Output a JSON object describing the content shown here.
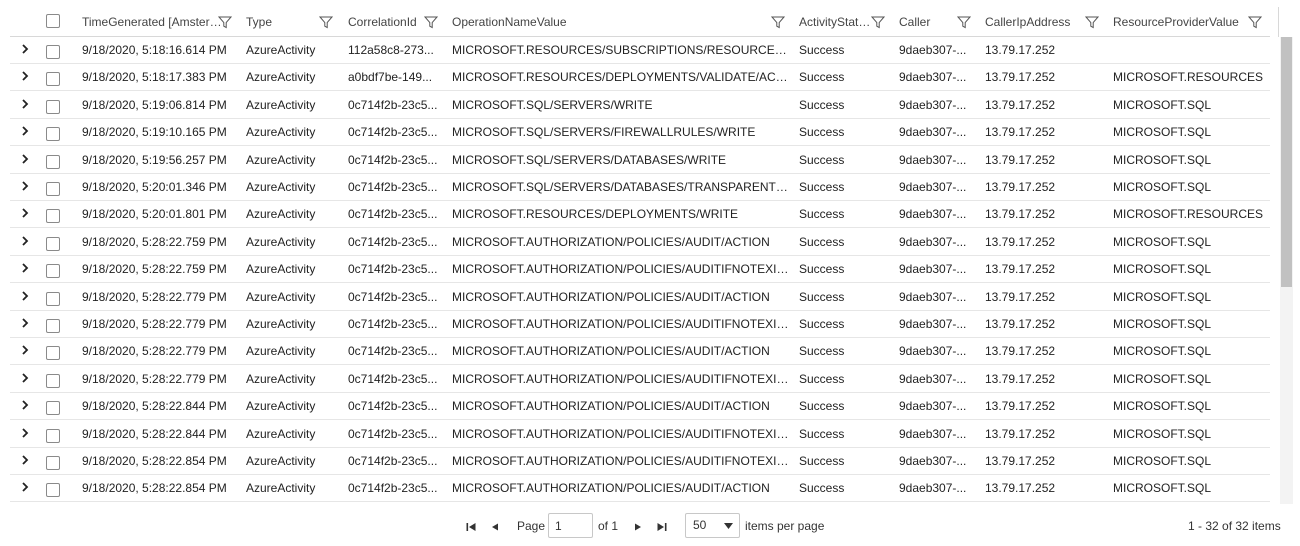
{
  "columns": [
    {
      "key": "time",
      "label": "TimeGenerated [Amster…"
    },
    {
      "key": "type",
      "label": "Type"
    },
    {
      "key": "corr",
      "label": "CorrelationId"
    },
    {
      "key": "op",
      "label": "OperationNameValue"
    },
    {
      "key": "status",
      "label": "ActivityStat…"
    },
    {
      "key": "caller",
      "label": "Caller"
    },
    {
      "key": "ip",
      "label": "CallerIpAddress"
    },
    {
      "key": "rp",
      "label": "ResourceProviderValue"
    }
  ],
  "rows": [
    {
      "time": "9/18/2020, 5:18:16.614 PM",
      "type": "AzureActivity",
      "corr": "112a58c8-273...",
      "op": "MICROSOFT.RESOURCES/SUBSCRIPTIONS/RESOURCEGROU...",
      "status": "Success",
      "caller": "9daeb307-...",
      "ip": "13.79.17.252",
      "rp": ""
    },
    {
      "time": "9/18/2020, 5:18:17.383 PM",
      "type": "AzureActivity",
      "corr": "a0bdf7be-149...",
      "op": "MICROSOFT.RESOURCES/DEPLOYMENTS/VALIDATE/ACTION",
      "status": "Success",
      "caller": "9daeb307-...",
      "ip": "13.79.17.252",
      "rp": "MICROSOFT.RESOURCES"
    },
    {
      "time": "9/18/2020, 5:19:06.814 PM",
      "type": "AzureActivity",
      "corr": "0c714f2b-23c5...",
      "op": "MICROSOFT.SQL/SERVERS/WRITE",
      "status": "Success",
      "caller": "9daeb307-...",
      "ip": "13.79.17.252",
      "rp": "MICROSOFT.SQL"
    },
    {
      "time": "9/18/2020, 5:19:10.165 PM",
      "type": "AzureActivity",
      "corr": "0c714f2b-23c5...",
      "op": "MICROSOFT.SQL/SERVERS/FIREWALLRULES/WRITE",
      "status": "Success",
      "caller": "9daeb307-...",
      "ip": "13.79.17.252",
      "rp": "MICROSOFT.SQL"
    },
    {
      "time": "9/18/2020, 5:19:56.257 PM",
      "type": "AzureActivity",
      "corr": "0c714f2b-23c5...",
      "op": "MICROSOFT.SQL/SERVERS/DATABASES/WRITE",
      "status": "Success",
      "caller": "9daeb307-...",
      "ip": "13.79.17.252",
      "rp": "MICROSOFT.SQL"
    },
    {
      "time": "9/18/2020, 5:20:01.346 PM",
      "type": "AzureActivity",
      "corr": "0c714f2b-23c5...",
      "op": "MICROSOFT.SQL/SERVERS/DATABASES/TRANSPARENTDAT...",
      "status": "Success",
      "caller": "9daeb307-...",
      "ip": "13.79.17.252",
      "rp": "MICROSOFT.SQL"
    },
    {
      "time": "9/18/2020, 5:20:01.801 PM",
      "type": "AzureActivity",
      "corr": "0c714f2b-23c5...",
      "op": "MICROSOFT.RESOURCES/DEPLOYMENTS/WRITE",
      "status": "Success",
      "caller": "9daeb307-...",
      "ip": "13.79.17.252",
      "rp": "MICROSOFT.RESOURCES"
    },
    {
      "time": "9/18/2020, 5:28:22.759 PM",
      "type": "AzureActivity",
      "corr": "0c714f2b-23c5...",
      "op": "MICROSOFT.AUTHORIZATION/POLICIES/AUDIT/ACTION",
      "status": "Success",
      "caller": "9daeb307-...",
      "ip": "13.79.17.252",
      "rp": "MICROSOFT.SQL"
    },
    {
      "time": "9/18/2020, 5:28:22.759 PM",
      "type": "AzureActivity",
      "corr": "0c714f2b-23c5...",
      "op": "MICROSOFT.AUTHORIZATION/POLICIES/AUDITIFNOTEXISTS...",
      "status": "Success",
      "caller": "9daeb307-...",
      "ip": "13.79.17.252",
      "rp": "MICROSOFT.SQL"
    },
    {
      "time": "9/18/2020, 5:28:22.779 PM",
      "type": "AzureActivity",
      "corr": "0c714f2b-23c5...",
      "op": "MICROSOFT.AUTHORIZATION/POLICIES/AUDIT/ACTION",
      "status": "Success",
      "caller": "9daeb307-...",
      "ip": "13.79.17.252",
      "rp": "MICROSOFT.SQL"
    },
    {
      "time": "9/18/2020, 5:28:22.779 PM",
      "type": "AzureActivity",
      "corr": "0c714f2b-23c5...",
      "op": "MICROSOFT.AUTHORIZATION/POLICIES/AUDITIFNOTEXISTS...",
      "status": "Success",
      "caller": "9daeb307-...",
      "ip": "13.79.17.252",
      "rp": "MICROSOFT.SQL"
    },
    {
      "time": "9/18/2020, 5:28:22.779 PM",
      "type": "AzureActivity",
      "corr": "0c714f2b-23c5...",
      "op": "MICROSOFT.AUTHORIZATION/POLICIES/AUDIT/ACTION",
      "status": "Success",
      "caller": "9daeb307-...",
      "ip": "13.79.17.252",
      "rp": "MICROSOFT.SQL"
    },
    {
      "time": "9/18/2020, 5:28:22.779 PM",
      "type": "AzureActivity",
      "corr": "0c714f2b-23c5...",
      "op": "MICROSOFT.AUTHORIZATION/POLICIES/AUDITIFNOTEXISTS...",
      "status": "Success",
      "caller": "9daeb307-...",
      "ip": "13.79.17.252",
      "rp": "MICROSOFT.SQL"
    },
    {
      "time": "9/18/2020, 5:28:22.844 PM",
      "type": "AzureActivity",
      "corr": "0c714f2b-23c5...",
      "op": "MICROSOFT.AUTHORIZATION/POLICIES/AUDIT/ACTION",
      "status": "Success",
      "caller": "9daeb307-...",
      "ip": "13.79.17.252",
      "rp": "MICROSOFT.SQL"
    },
    {
      "time": "9/18/2020, 5:28:22.844 PM",
      "type": "AzureActivity",
      "corr": "0c714f2b-23c5...",
      "op": "MICROSOFT.AUTHORIZATION/POLICIES/AUDITIFNOTEXISTS...",
      "status": "Success",
      "caller": "9daeb307-...",
      "ip": "13.79.17.252",
      "rp": "MICROSOFT.SQL"
    },
    {
      "time": "9/18/2020, 5:28:22.854 PM",
      "type": "AzureActivity",
      "corr": "0c714f2b-23c5...",
      "op": "MICROSOFT.AUTHORIZATION/POLICIES/AUDITIFNOTEXISTS...",
      "status": "Success",
      "caller": "9daeb307-...",
      "ip": "13.79.17.252",
      "rp": "MICROSOFT.SQL"
    },
    {
      "time": "9/18/2020, 5:28:22.854 PM",
      "type": "AzureActivity",
      "corr": "0c714f2b-23c5...",
      "op": "MICROSOFT.AUTHORIZATION/POLICIES/AUDIT/ACTION",
      "status": "Success",
      "caller": "9daeb307-...",
      "ip": "13.79.17.252",
      "rp": "MICROSOFT.SQL"
    }
  ],
  "pager": {
    "page_label": "Page",
    "page_value": "1",
    "of_label": "of 1",
    "page_size": "50",
    "per_page_label": "items per page",
    "summary": "1 - 32 of 32 items"
  },
  "icons": {
    "filter": "filter-funnel-icon",
    "expand": "chevron-right-icon",
    "first": "first-page-icon",
    "prev": "previous-page-icon",
    "next": "next-page-icon",
    "last": "last-page-icon",
    "dropdown": "dropdown-caret-icon"
  },
  "colors": {
    "border": "#e6e6e6",
    "scroll_thumb": "#c1c1c1"
  }
}
